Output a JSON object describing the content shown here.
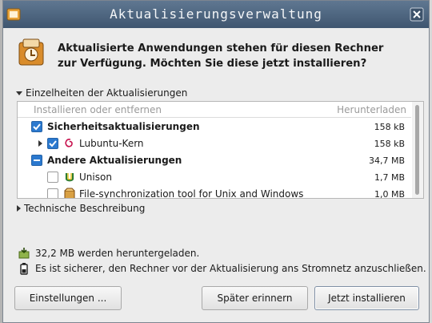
{
  "window": {
    "title": "Aktualisierungsverwaltung"
  },
  "header": {
    "line1": "Aktualisierte Anwendungen stehen für diesen Rechner",
    "line2": "zur Verfügung. Möchten Sie diese jetzt installieren?",
    "icon": "software-update-icon"
  },
  "details_expander": {
    "label": "Einzelheiten der Aktualisierungen",
    "expanded": true
  },
  "update_list": {
    "columns": {
      "name": "Installieren oder entfernen",
      "size": "Herunterladen"
    },
    "rows": [
      {
        "label": "Sicherheitsaktualisierungen",
        "size": "158 kB",
        "state": "checked",
        "bold": true
      },
      {
        "label": "Lubuntu-Kern",
        "size": "158 kB",
        "state": "checked",
        "bold": false,
        "icon": "debian-swirl-icon"
      },
      {
        "label": "Andere Aktualisierungen",
        "size": "34,7 MB",
        "state": "partial",
        "bold": true
      },
      {
        "label": "Unison",
        "size": "1,7 MB",
        "state": "unchecked",
        "bold": false,
        "icon": "unison-icon"
      },
      {
        "label": "File-synchronization tool for Unix and Windows",
        "size": "1,0 MB",
        "state": "unchecked",
        "bold": false,
        "icon": "package-icon"
      }
    ]
  },
  "tech_expander": {
    "label": "Technische Beschreibung",
    "expanded": false
  },
  "info": {
    "download_text": "32,2 MB werden heruntergeladen.",
    "power_text": "Es ist sicherer, den Rechner vor der Aktualisierung ans Stromnetz anzuschließen."
  },
  "buttons": {
    "settings": "Einstellungen ...",
    "remind_later": "Später erinnern",
    "install_now": "Jetzt installieren"
  },
  "colors": {
    "titlebar": "#4b6580",
    "checkbox": "#2b79cf"
  }
}
